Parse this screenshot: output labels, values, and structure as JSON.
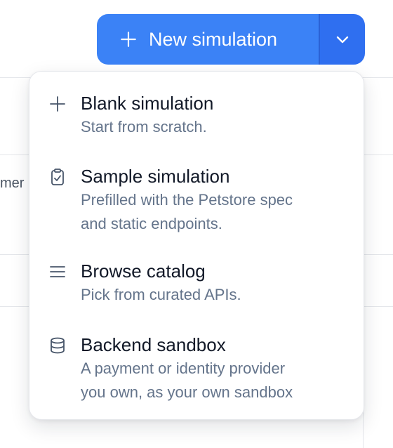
{
  "background": {
    "cut_off_text": "mer"
  },
  "split_button": {
    "label": "New simulation",
    "main_color": "#3b82f6",
    "toggle_color": "#2f6ff0",
    "icon": "plus-icon",
    "toggle_icon": "chevron-down-icon"
  },
  "menu": {
    "items": [
      {
        "icon": "plus-icon",
        "title": "Blank simulation",
        "description": [
          "Start from scratch."
        ]
      },
      {
        "icon": "clipboard-check-icon",
        "title": "Sample simulation",
        "description": [
          "Prefilled with the Petstore spec",
          "and static endpoints."
        ]
      },
      {
        "icon": "list-icon",
        "title": "Browse catalog",
        "description": [
          "Pick from curated APIs."
        ]
      },
      {
        "icon": "database-icon",
        "title": "Backend sandbox",
        "description": [
          "A payment or identity provider",
          "you own, as your own sandbox"
        ]
      }
    ]
  }
}
